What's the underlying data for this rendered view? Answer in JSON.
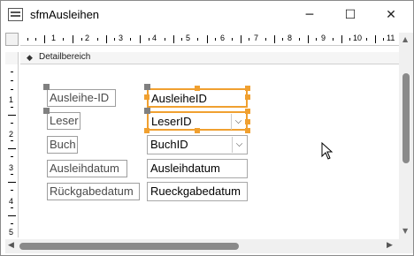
{
  "window": {
    "title": "sfmAusleihen",
    "minimize": "─",
    "maximize": "☐",
    "close": "✕"
  },
  "ruler": {
    "h_numbers": [
      "1",
      "2",
      "3",
      "4",
      "5",
      "6",
      "7",
      "8",
      "9",
      "10",
      "11"
    ],
    "v_numbers": [
      "1",
      "2",
      "3",
      "4",
      "5"
    ]
  },
  "section": {
    "arrow": "◆",
    "label": "Detailbereich"
  },
  "form": {
    "labels": [
      {
        "text": "Ausleihe-ID"
      },
      {
        "text": "Leser"
      },
      {
        "text": "Buch"
      },
      {
        "text": "Ausleihdatum"
      },
      {
        "text": "Rückgabedatum"
      }
    ],
    "controls": [
      {
        "text": "AusleiheID",
        "kind": "textbox"
      },
      {
        "text": "LeserID",
        "kind": "combobox",
        "arrow": "⌵"
      },
      {
        "text": "BuchID",
        "kind": "combobox",
        "arrow": "⌵"
      },
      {
        "text": "Ausleihdatum",
        "kind": "textbox"
      },
      {
        "text": "Rueckgabedatum",
        "kind": "textbox"
      }
    ]
  },
  "scroll": {
    "left_arrow": "◀",
    "right_arrow": "▶",
    "up_arrow": "▲",
    "down_arrow": "▼"
  },
  "colors": {
    "selection": "#f0a030",
    "label_border": "#9e9e9e",
    "scroll_thumb": "#8a8a8a"
  }
}
